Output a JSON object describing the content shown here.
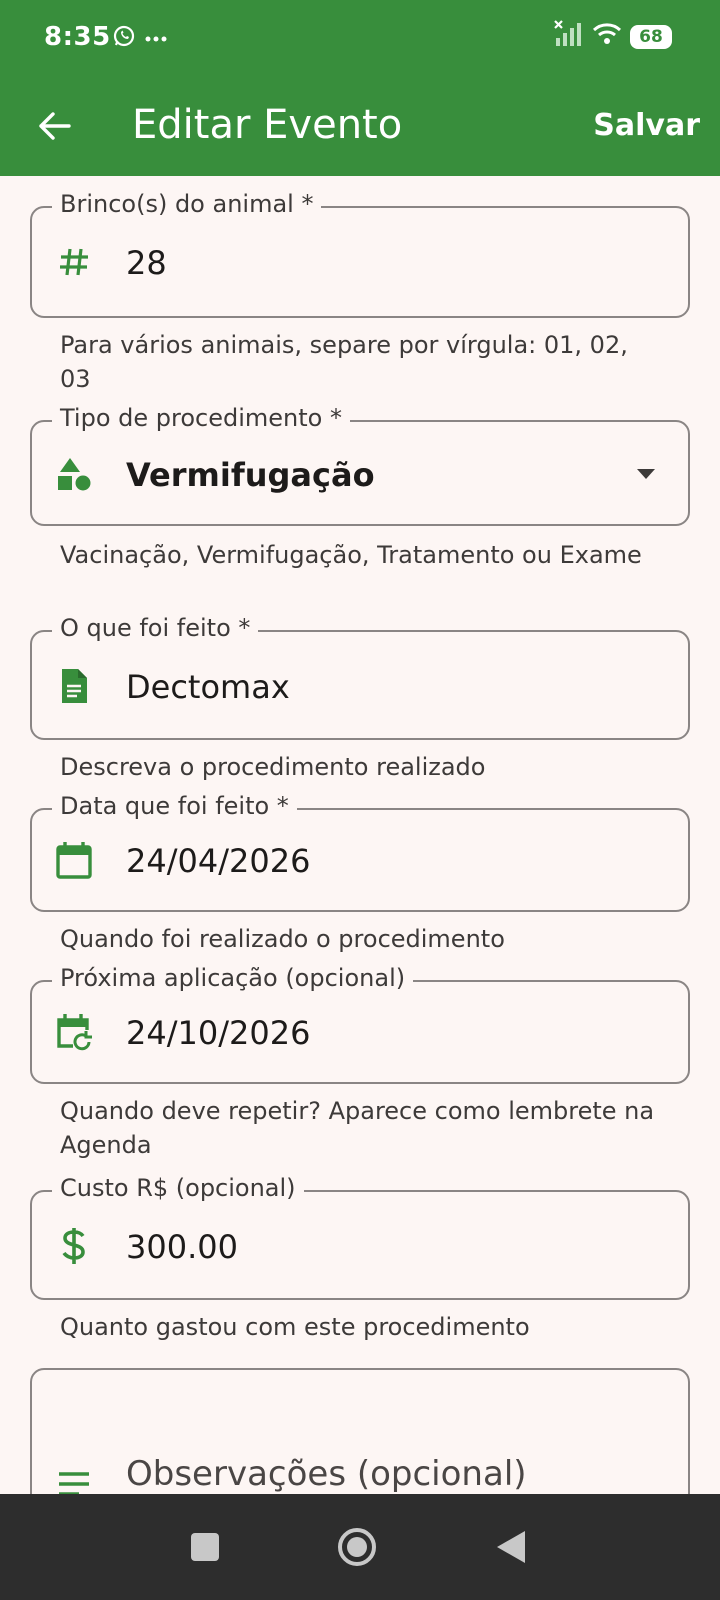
{
  "status_bar": {
    "time": "8:35",
    "icons": [
      "whatsapp-icon",
      "more-icon",
      "signal-off-icon",
      "wifi-icon"
    ],
    "battery": "68"
  },
  "app_bar": {
    "title": "Editar Evento",
    "save_label": "Salvar",
    "background": "#388e3c"
  },
  "form": {
    "brinco": {
      "label": "Brinco(s) do animal *",
      "value": "28",
      "helper": "Para vários animais, separe por vírgula: 01, 02, 03",
      "icon": "hash-icon"
    },
    "tipo": {
      "label": "Tipo de procedimento *",
      "value": "Vermifugação",
      "helper": "Vacinação, Vermifugação, Tratamento ou Exame",
      "icon": "shapes-icon"
    },
    "feito": {
      "label": "O que foi feito *",
      "value": "Dectomax",
      "helper": "Descreva o procedimento realizado",
      "icon": "document-icon"
    },
    "data": {
      "label": "Data que foi feito *",
      "value": "24/04/2026",
      "helper": "Quando foi realizado o procedimento",
      "icon": "calendar-icon"
    },
    "proxima": {
      "label": "Próxima aplicação (opcional)",
      "value": "24/10/2026",
      "helper": "Quando deve repetir? Aparece como lembrete na Agenda",
      "icon": "calendar-repeat-icon"
    },
    "custo": {
      "label": "Custo R$ (opcional)",
      "value": "300.00",
      "helper": "Quanto gastou com este procedimento",
      "icon": "dollar-icon"
    },
    "observacoes": {
      "placeholder": "Observações (opcional)",
      "icon": "notes-icon"
    }
  },
  "colors": {
    "accent": "#388e3c",
    "background": "#fdf6f4",
    "nav_bar": "#2d2d2d"
  }
}
